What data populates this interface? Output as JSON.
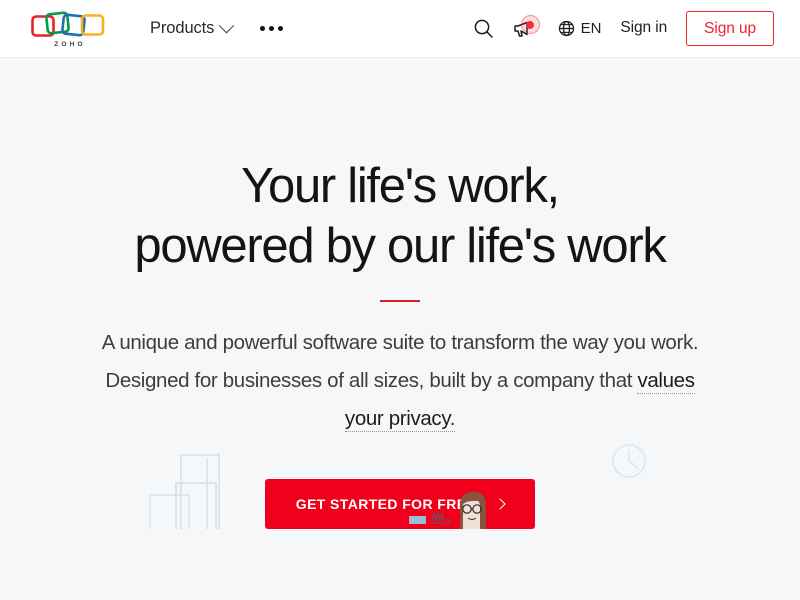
{
  "header": {
    "logo": {
      "name": "zoho-logo",
      "wordmark": "ZOHO",
      "colors": [
        "#e42527",
        "#089949",
        "#226db4",
        "#f9b21d"
      ]
    },
    "nav_left": [
      {
        "label": "Products",
        "icon": "chevron-down-icon",
        "has_dropdown": true
      },
      {
        "label": "",
        "icon": "more-dots-icon",
        "has_dropdown": false
      }
    ],
    "search_icon": "search-icon",
    "announcement_icon": "megaphone-icon",
    "announcement_badge": true,
    "language": {
      "icon": "globe-icon",
      "code": "EN"
    },
    "sign_in_label": "Sign in",
    "sign_up_label": "Sign up",
    "accent_color": "#f0232f"
  },
  "hero": {
    "headline_line1": "Your life's work,",
    "headline_line2": "powered by our life's work",
    "divider_color": "#e01a21",
    "paragraph_part1": "A unique and powerful software suite to transform the way you work. Designed for businesses of all sizes, built by a company that ",
    "paragraph_link": "values your privacy.",
    "cta_label": "GET STARTED FOR FREE",
    "cta_icon": "chevron-right-icon",
    "cta_color": "#f0001a"
  },
  "illustration": {
    "bars_label": "bar-chart-outline",
    "person_label": "person-with-glasses",
    "clock_label": "clock-outline",
    "line_color": "#d7e4f0"
  }
}
